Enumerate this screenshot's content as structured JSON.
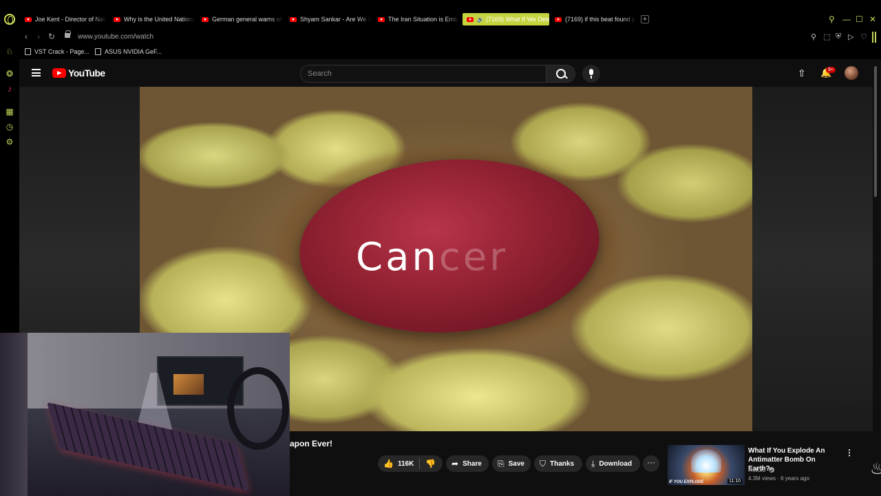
{
  "tabs": [
    {
      "title": "Joe Kent - Director of Nati",
      "active": false
    },
    {
      "title": "Why is the United Nations",
      "active": false
    },
    {
      "title": "German general warns of",
      "active": false
    },
    {
      "title": "Shyam Sankar - Are We S",
      "active": false
    },
    {
      "title": "The Iran Situation is Emba",
      "active": false
    },
    {
      "title": "(7169) What If We Dete",
      "active": true
    },
    {
      "title": "(7169) if this beat found yo",
      "active": false
    }
  ],
  "new_tab_label": "+",
  "window_controls": {
    "search": "⚲",
    "minimize": "—",
    "maximize": "☐",
    "close": "✕"
  },
  "address": {
    "url": "www.youtube.com/watch"
  },
  "bookmarks": [
    {
      "label": "VST Crack - Page..."
    },
    {
      "label": "ASUS NVIDIA GeF..."
    }
  ],
  "youtube": {
    "wordmark": "YouTube",
    "search_placeholder": "Search",
    "notification_count": "9+"
  },
  "video": {
    "overlay_text_visible": "Can",
    "overlay_text_faded": "cer",
    "title_visible": "apon Ever!"
  },
  "actions": {
    "like_count": "116K",
    "share": "Share",
    "save": "Save",
    "thanks": "Thanks",
    "download": "Download",
    "more": "···"
  },
  "recommended": {
    "title": "What If You Explode An Antimatter Bomb On Earth?",
    "channel": "Riddle",
    "views": "4.3M views",
    "age": "6 years ago",
    "meta": "4.3M views · 6 years ago",
    "thumb_text": "IF YOU EXPLODE",
    "duration": "11:10",
    "menu": "⋮"
  },
  "colors": {
    "opera_accent": "#c6d65a",
    "youtube_red": "#ff0000",
    "page_bg": "#0f0f0f",
    "active_tab": "#c5d33f"
  }
}
